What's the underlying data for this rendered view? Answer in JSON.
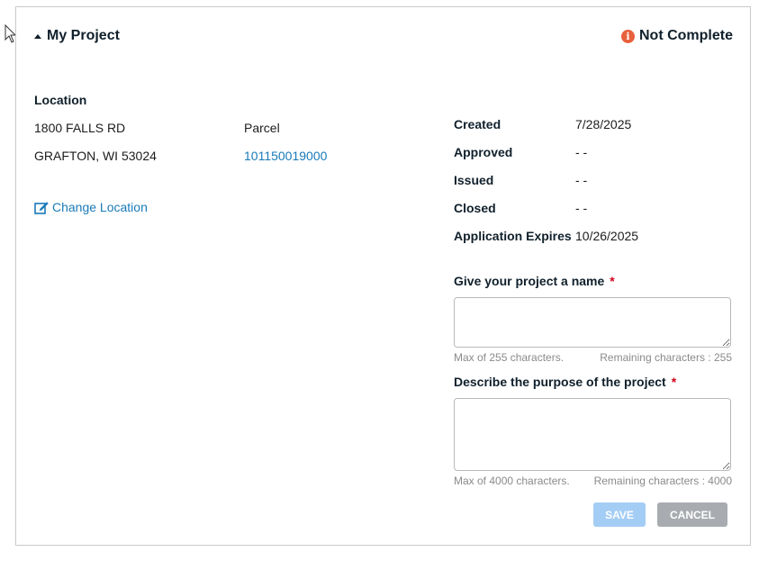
{
  "header": {
    "title": "My Project",
    "status": "Not Complete",
    "status_icon": "info-icon"
  },
  "location": {
    "heading": "Location",
    "address_line1": "1800 FALLS RD",
    "address_line2": "GRAFTON, WI 53024",
    "parcel_label": "Parcel",
    "parcel_number": "101150019000",
    "change_location": "Change Location"
  },
  "details": {
    "created_label": "Created",
    "created_value": "7/28/2025",
    "approved_label": "Approved",
    "approved_value": "- -",
    "issued_label": "Issued",
    "issued_value": "- -",
    "closed_label": "Closed",
    "closed_value": "- -",
    "expires_label": "Application Expires",
    "expires_value": "10/26/2025"
  },
  "form": {
    "name_label": "Give your project a name",
    "name_value": "",
    "name_max": "Max of 255 characters.",
    "name_remaining": "Remaining characters : 255",
    "purpose_label": "Describe the purpose of the project",
    "purpose_value": "",
    "purpose_max": "Max of 4000 characters.",
    "purpose_remaining": "Remaining characters : 4000",
    "required_mark": "*"
  },
  "buttons": {
    "save": "SAVE",
    "cancel": "CANCEL"
  },
  "colors": {
    "accent": "#1a7ab8",
    "status_icon": "#e8603c",
    "required": "#d0021b",
    "save_bg": "#a4cdf5",
    "cancel_bg": "#a8acb0"
  }
}
